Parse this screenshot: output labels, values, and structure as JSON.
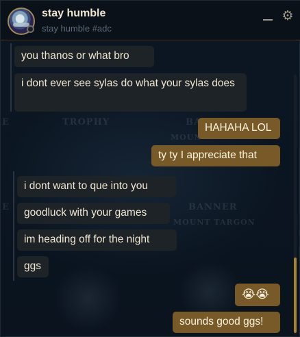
{
  "header": {
    "title": "stay humble",
    "subtitle": "stay humble #adc"
  },
  "icons": {
    "minimize": "minimize-icon",
    "settings": "gear-icon"
  },
  "background": {
    "labels": [
      "TROPHY",
      "BA",
      "MOUN",
      "BANNER",
      "MOUNT TARGON",
      "E",
      "E"
    ]
  },
  "messages": [
    {
      "from": "them",
      "text": "you thanos or what bro"
    },
    {
      "from": "them",
      "text": "i dont ever see sylas do what your sylas does"
    },
    {
      "from": "me",
      "text": "HAHAHA LOL"
    },
    {
      "from": "me",
      "text": "ty ty I appreciate that"
    },
    {
      "from": "them",
      "text": "i dont want to que into you"
    },
    {
      "from": "them",
      "text": "goodluck with your games"
    },
    {
      "from": "them",
      "text": "im heading off for the night"
    },
    {
      "from": "them",
      "text": "ggs"
    },
    {
      "from": "me",
      "text": "😭😭"
    },
    {
      "from": "me",
      "text": "sounds good ggs!"
    }
  ],
  "colors": {
    "incoming_bubble": "#1e2328",
    "outgoing_bubble": "#785a28",
    "accent_gold": "#a8842e"
  }
}
